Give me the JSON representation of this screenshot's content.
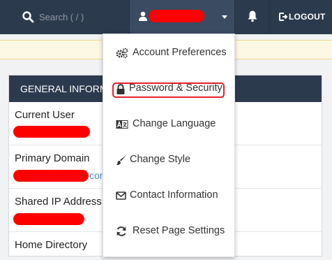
{
  "header": {
    "search_placeholder": "Search ( / )",
    "logout_label": "LOGOUT"
  },
  "panel": {
    "heading": "GENERAL INFORMATION",
    "rows": [
      {
        "label": "Current User"
      },
      {
        "label": "Primary Domain",
        "partial_link_text": "com"
      },
      {
        "label": "Shared IP Address"
      },
      {
        "label": "Home Directory"
      }
    ]
  },
  "user_menu": {
    "items": [
      {
        "label": "Account Preferences",
        "icon": "cogs-icon"
      },
      {
        "label": "Password & Security",
        "icon": "lock-icon",
        "highlighted": true
      },
      {
        "label": "Change Language",
        "icon": "language-icon"
      },
      {
        "label": "Change Style",
        "icon": "paintbrush-icon"
      },
      {
        "label": "Contact Information",
        "icon": "envelope-icon"
      },
      {
        "label": "Reset Page Settings",
        "icon": "refresh-icon"
      }
    ]
  },
  "colors": {
    "topbar": "#2c3a4e",
    "redaction": "#ff0000",
    "highlight_border": "#e8202a",
    "notice_bg": "#fcf8e3"
  }
}
